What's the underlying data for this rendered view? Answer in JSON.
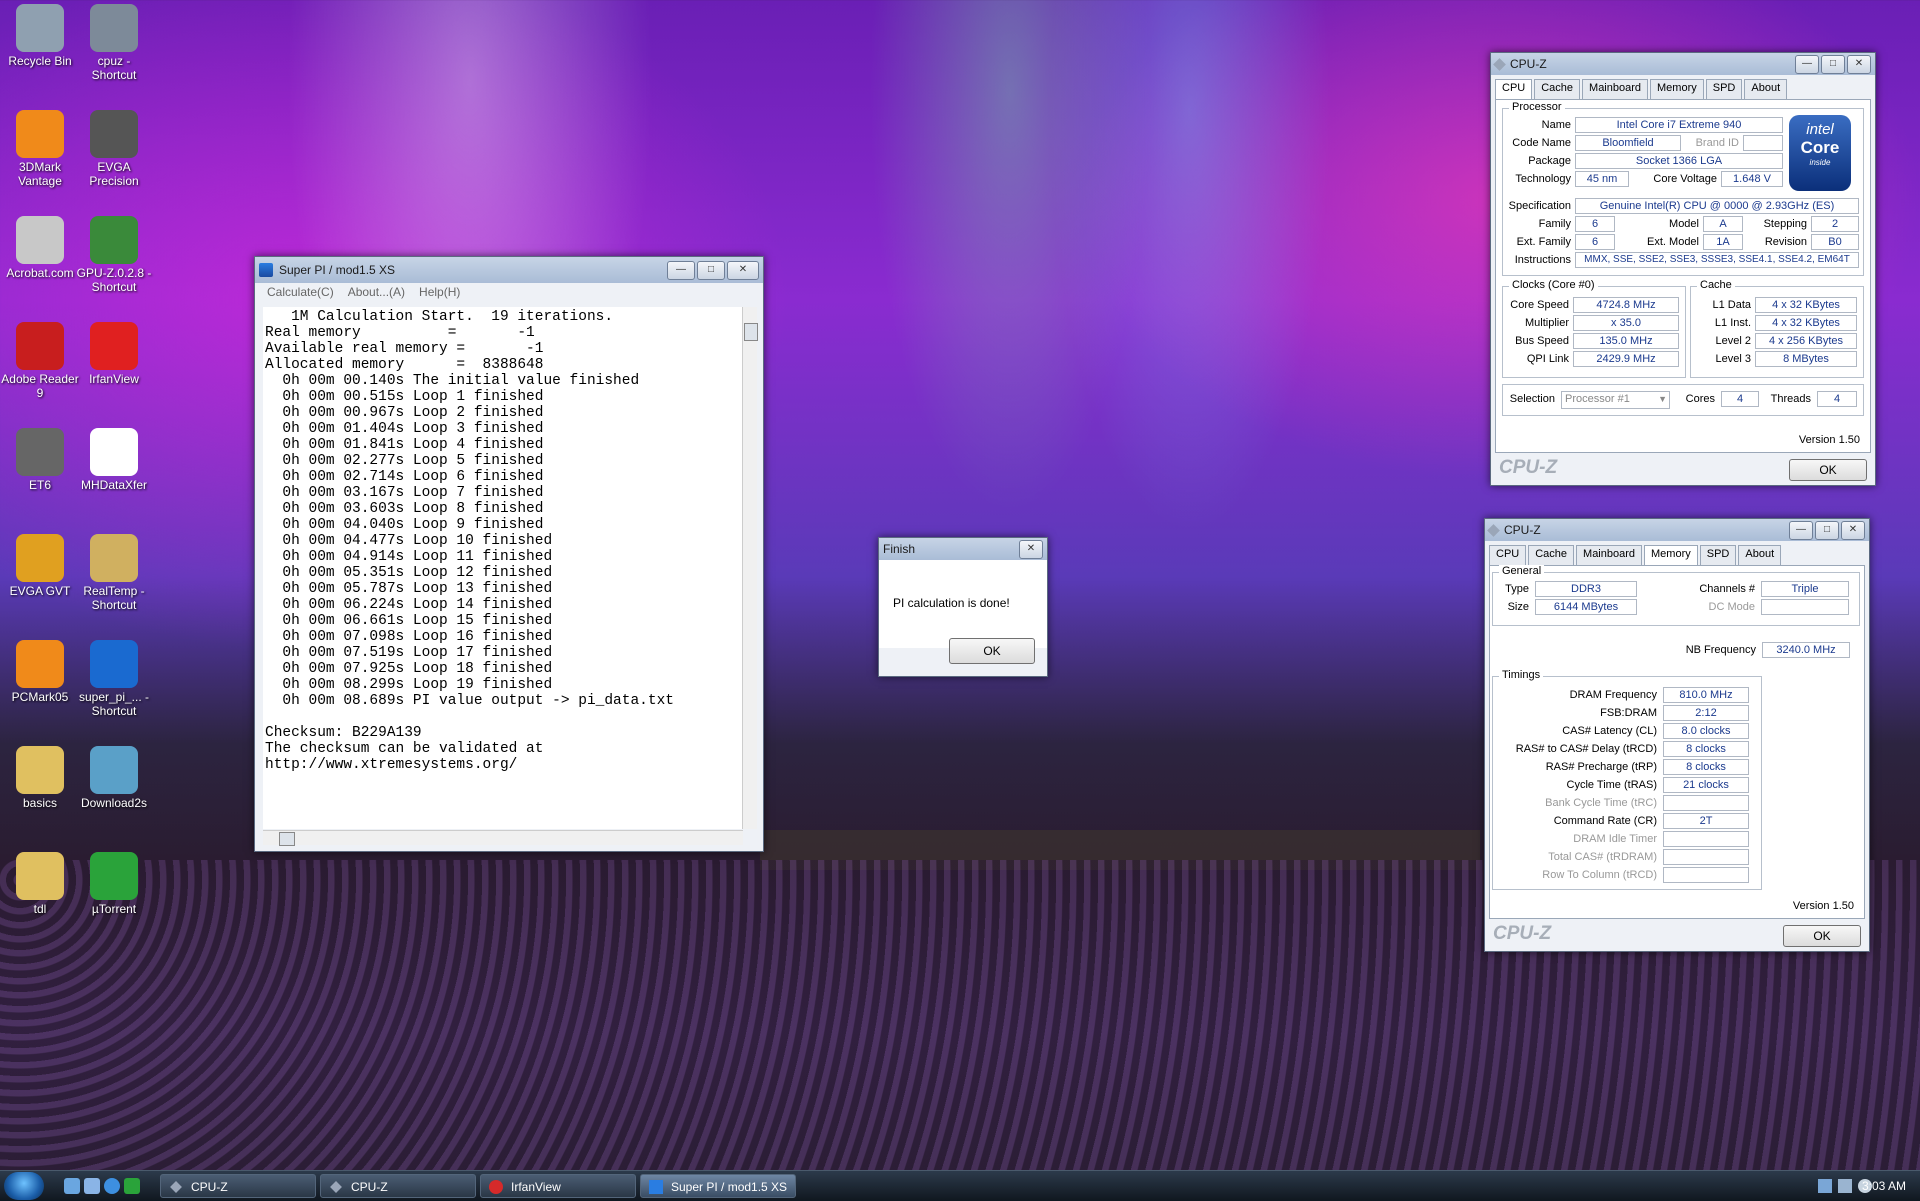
{
  "desktop": {
    "icons": [
      {
        "label": "Recycle Bin"
      },
      {
        "label": "cpuz - Shortcut"
      },
      {
        "label": "3DMark Vantage"
      },
      {
        "label": "EVGA Precision"
      },
      {
        "label": "Acrobat.com"
      },
      {
        "label": "GPU-Z.0.2.8 - Shortcut"
      },
      {
        "label": "Adobe Reader 9"
      },
      {
        "label": "IrfanView"
      },
      {
        "label": "ET6"
      },
      {
        "label": "MHDataXfer"
      },
      {
        "label": "EVGA GVT"
      },
      {
        "label": "RealTemp - Shortcut"
      },
      {
        "label": "PCMark05"
      },
      {
        "label": "super_pi_... - Shortcut"
      },
      {
        "label": "basics"
      },
      {
        "label": "Download2s"
      },
      {
        "label": "tdl"
      },
      {
        "label": "µTorrent"
      }
    ]
  },
  "superpi": {
    "title": "Super PI / mod1.5 XS",
    "menu": [
      "Calculate(C)",
      "About...(A)",
      "Help(H)"
    ],
    "lines": [
      "   1M Calculation Start.  19 iterations.",
      "Real memory          =       -1",
      "Available real memory =       -1",
      "Allocated memory      =  8388648",
      "  0h 00m 00.140s The initial value finished",
      "  0h 00m 00.515s Loop 1 finished",
      "  0h 00m 00.967s Loop 2 finished",
      "  0h 00m 01.404s Loop 3 finished",
      "  0h 00m 01.841s Loop 4 finished",
      "  0h 00m 02.277s Loop 5 finished",
      "  0h 00m 02.714s Loop 6 finished",
      "  0h 00m 03.167s Loop 7 finished",
      "  0h 00m 03.603s Loop 8 finished",
      "  0h 00m 04.040s Loop 9 finished",
      "  0h 00m 04.477s Loop 10 finished",
      "  0h 00m 04.914s Loop 11 finished",
      "  0h 00m 05.351s Loop 12 finished",
      "  0h 00m 05.787s Loop 13 finished",
      "  0h 00m 06.224s Loop 14 finished",
      "  0h 00m 06.661s Loop 15 finished",
      "  0h 00m 07.098s Loop 16 finished",
      "  0h 00m 07.519s Loop 17 finished",
      "  0h 00m 07.925s Loop 18 finished",
      "  0h 00m 08.299s Loop 19 finished",
      "  0h 00m 08.689s PI value output -> pi_data.txt",
      "",
      "Checksum: B229A139",
      "The checksum can be validated at",
      "http://www.xtremesystems.org/"
    ]
  },
  "finish": {
    "title": "Finish",
    "message": "PI calculation is done!",
    "ok": "OK"
  },
  "cpuz_cpu": {
    "title": "CPU-Z",
    "tabs": [
      "CPU",
      "Cache",
      "Mainboard",
      "Memory",
      "SPD",
      "About"
    ],
    "processor_group": "Processor",
    "name_lbl": "Name",
    "name": "Intel Core i7 Extreme 940",
    "codename_lbl": "Code Name",
    "codename": "Bloomfield",
    "brandid_lbl": "Brand ID",
    "package_lbl": "Package",
    "package": "Socket 1366 LGA",
    "tech_lbl": "Technology",
    "tech": "45 nm",
    "voltage_lbl": "Core Voltage",
    "voltage": "1.648 V",
    "spec_lbl": "Specification",
    "spec": "Genuine Intel(R) CPU          @ 0000 @ 2.93GHz (ES)",
    "family_lbl": "Family",
    "family": "6",
    "model_lbl": "Model",
    "model": "A",
    "stepping_lbl": "Stepping",
    "stepping": "2",
    "extfam_lbl": "Ext. Family",
    "extfam": "6",
    "extmodel_lbl": "Ext. Model",
    "extmodel": "1A",
    "revision_lbl": "Revision",
    "revision": "B0",
    "instr_lbl": "Instructions",
    "instr": "MMX, SSE, SSE2, SSE3, SSSE3, SSE4.1, SSE4.2, EM64T",
    "clocks_group": "Clocks (Core #0)",
    "corespeed_lbl": "Core Speed",
    "corespeed": "4724.8 MHz",
    "mult_lbl": "Multiplier",
    "mult": "x 35.0",
    "bus_lbl": "Bus Speed",
    "bus": "135.0 MHz",
    "qpi_lbl": "QPI Link",
    "qpi": "2429.9 MHz",
    "cache_group": "Cache",
    "l1d_lbl": "L1 Data",
    "l1d": "4 x 32 KBytes",
    "l1i_lbl": "L1 Inst.",
    "l1i": "4 x 32 KBytes",
    "l2_lbl": "Level 2",
    "l2": "4 x 256 KBytes",
    "l3_lbl": "Level 3",
    "l3": "8 MBytes",
    "selection_lbl": "Selection",
    "selection": "Processor #1",
    "cores_lbl": "Cores",
    "cores": "4",
    "threads_lbl": "Threads",
    "threads": "4",
    "version": "Version 1.50",
    "brand": "CPU-Z",
    "ok": "OK",
    "intel_logo": {
      "top": "intel",
      "mid": "Core",
      "bot": "inside"
    }
  },
  "cpuz_mem": {
    "title": "CPU-Z",
    "tabs": [
      "CPU",
      "Cache",
      "Mainboard",
      "Memory",
      "SPD",
      "About"
    ],
    "general_group": "General",
    "type_lbl": "Type",
    "type": "DDR3",
    "size_lbl": "Size",
    "size": "6144 MBytes",
    "channels_lbl": "Channels #",
    "channels": "Triple",
    "dcmode_lbl": "DC Mode",
    "nbfreq_lbl": "NB Frequency",
    "nbfreq": "3240.0 MHz",
    "timings_group": "Timings",
    "timings": [
      {
        "label": "DRAM Frequency",
        "value": "810.0 MHz",
        "dim": false
      },
      {
        "label": "FSB:DRAM",
        "value": "2:12",
        "dim": false
      },
      {
        "label": "CAS# Latency (CL)",
        "value": "8.0 clocks",
        "dim": false
      },
      {
        "label": "RAS# to CAS# Delay (tRCD)",
        "value": "8 clocks",
        "dim": false
      },
      {
        "label": "RAS# Precharge (tRP)",
        "value": "8 clocks",
        "dim": false
      },
      {
        "label": "Cycle Time (tRAS)",
        "value": "21 clocks",
        "dim": false
      },
      {
        "label": "Bank Cycle Time (tRC)",
        "value": "",
        "dim": true
      },
      {
        "label": "Command Rate (CR)",
        "value": "2T",
        "dim": false
      },
      {
        "label": "DRAM Idle Timer",
        "value": "",
        "dim": true
      },
      {
        "label": "Total CAS# (tRDRAM)",
        "value": "",
        "dim": true
      },
      {
        "label": "Row To Column (tRCD)",
        "value": "",
        "dim": true
      }
    ],
    "version": "Version 1.50",
    "brand": "CPU-Z",
    "ok": "OK"
  },
  "taskbar": {
    "buttons": [
      "CPU-Z",
      "CPU-Z",
      "IrfanView",
      "Super PI / mod1.5 XS"
    ],
    "clock": "3:03 AM"
  },
  "colors": {
    "value_text": "#1b3a8e",
    "taskbar": "#1a2430"
  }
}
